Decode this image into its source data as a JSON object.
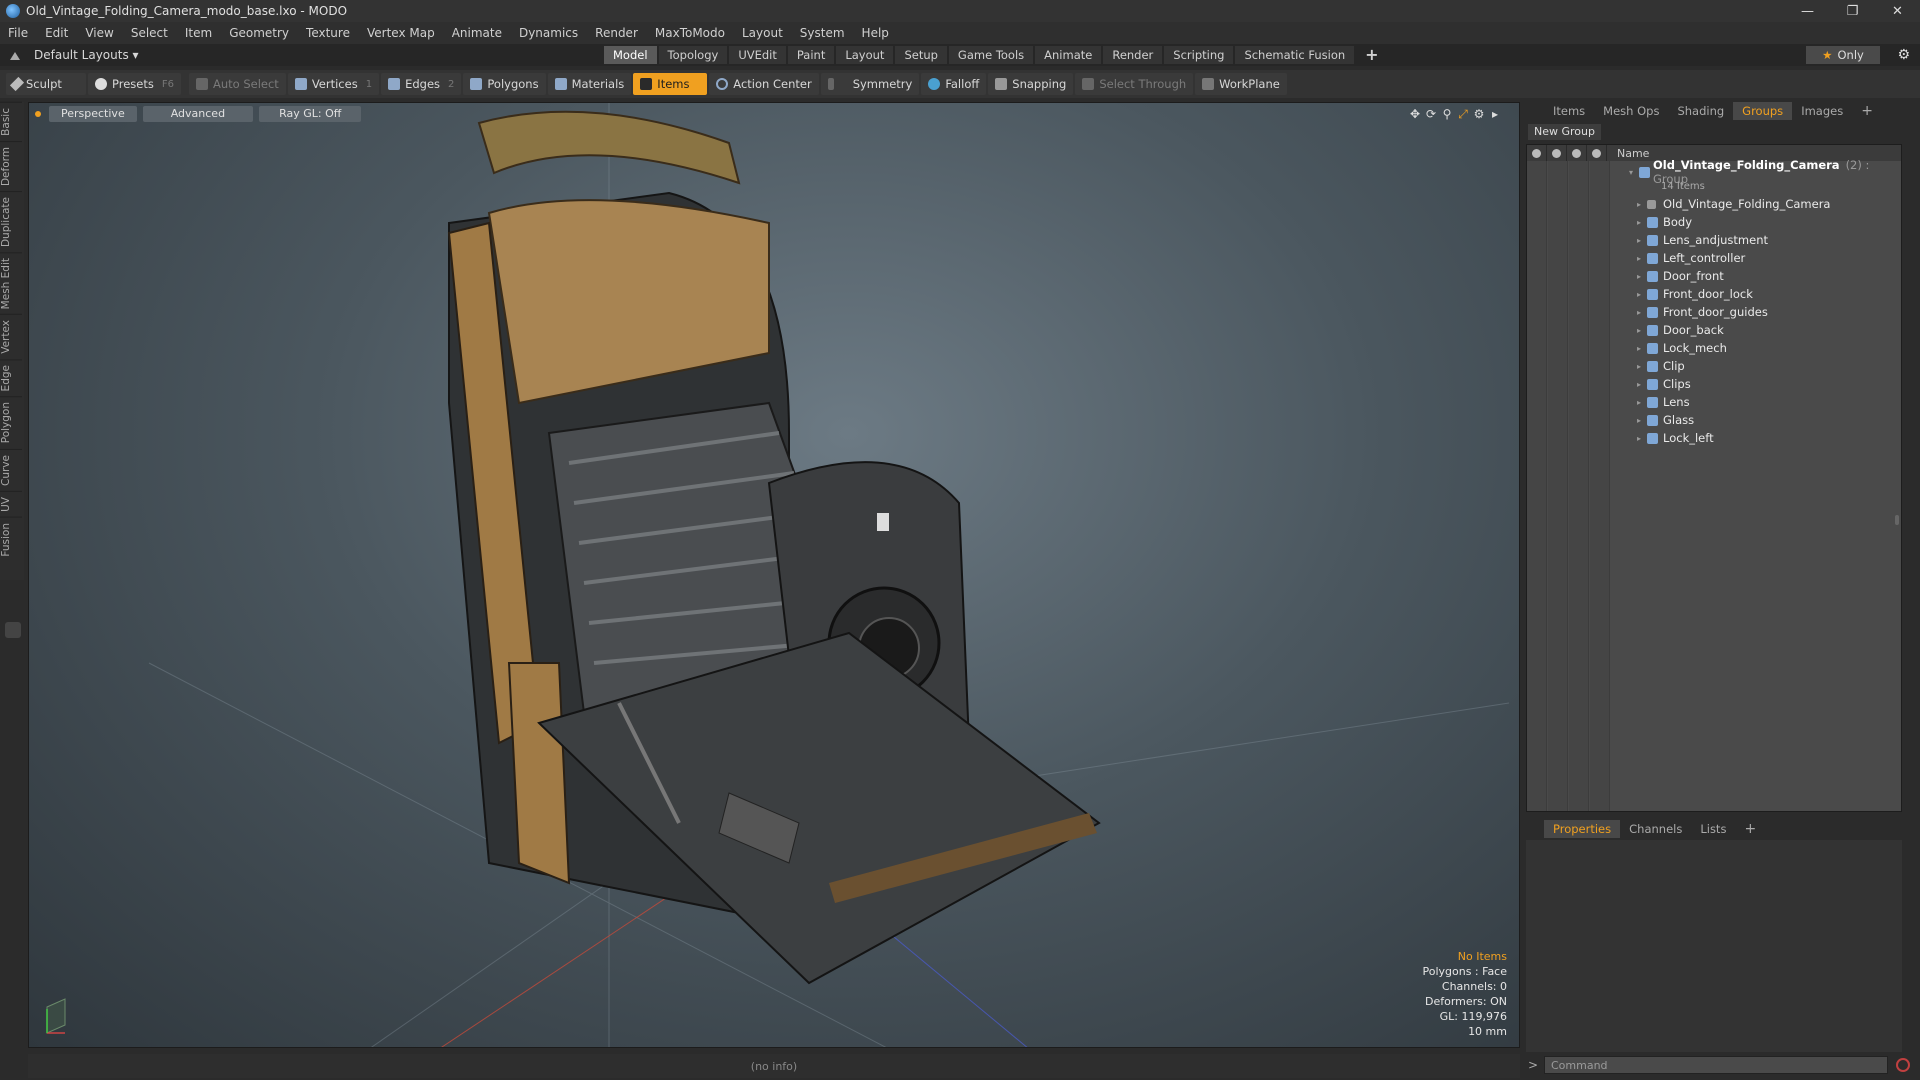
{
  "window": {
    "title": "Old_Vintage_Folding_Camera_modo_base.lxo - MODO"
  },
  "menu": [
    "File",
    "Edit",
    "View",
    "Select",
    "Item",
    "Geometry",
    "Texture",
    "Vertex Map",
    "Animate",
    "Dynamics",
    "Render",
    "MaxToModo",
    "Layout",
    "System",
    "Help"
  ],
  "layouts": {
    "selector": "Default Layouts ▾",
    "tabs": [
      "Model",
      "Topology",
      "UVEdit",
      "Paint",
      "Layout",
      "Setup",
      "Game Tools",
      "Animate",
      "Render",
      "Scripting",
      "Schematic Fusion"
    ],
    "active_tab": "Model",
    "plus": "+",
    "only_star": "★",
    "only_label": "Only"
  },
  "toolbar": {
    "sculpt": "Sculpt",
    "presets": "Presets",
    "presets_key": "F6",
    "auto_select": "Auto Select",
    "vertices": "Vertices",
    "vertices_key": "1",
    "edges": "Edges",
    "edges_key": "2",
    "polygons": "Polygons",
    "materials": "Materials",
    "items": "Items",
    "action_center": "Action Center",
    "symmetry": "Symmetry",
    "falloff": "Falloff",
    "snapping": "Snapping",
    "select_through": "Select Through",
    "workplane": "WorkPlane"
  },
  "left_tabs": [
    "Basic",
    "Deform",
    "Duplicate",
    "Mesh Edit",
    "Vertex",
    "Edge",
    "Polygon",
    "Curve",
    "UV",
    "Fusion"
  ],
  "viewport": {
    "view": "Perspective",
    "shading": "Advanced",
    "raygl": "Ray GL: Off",
    "stats": [
      "No Items",
      "Polygons : Face",
      "Channels: 0",
      "Deformers: ON",
      "GL: 119,976",
      "10 mm"
    ]
  },
  "status": {
    "info": "(no info)"
  },
  "right_panel": {
    "tabs": [
      "Items",
      "Mesh Ops",
      "Shading",
      "Groups",
      "Images"
    ],
    "active_tab": "Groups",
    "new_group": "New Group",
    "column_name": "Name",
    "group": {
      "name": "Old_Vintage_Folding_Camera",
      "count": "(2) : Group",
      "sub": "14 Items"
    },
    "items": [
      "Old_Vintage_Folding_Camera",
      "Body",
      "Lens_andjustment",
      "Left_controller",
      "Door_front",
      "Front_door_lock",
      "Front_door_guides",
      "Door_back",
      "Lock_mech",
      "Clip",
      "Clips",
      "Lens",
      "Glass",
      "Lock_left"
    ]
  },
  "properties_panel": {
    "tabs": [
      "Properties",
      "Channels",
      "Lists"
    ],
    "active_tab": "Properties"
  },
  "command": {
    "placeholder": "Command",
    "prompt": ">"
  },
  "colors": {
    "accent": "#f0a020",
    "panel": "#2b2b2b",
    "viewport": "#4b575f"
  }
}
